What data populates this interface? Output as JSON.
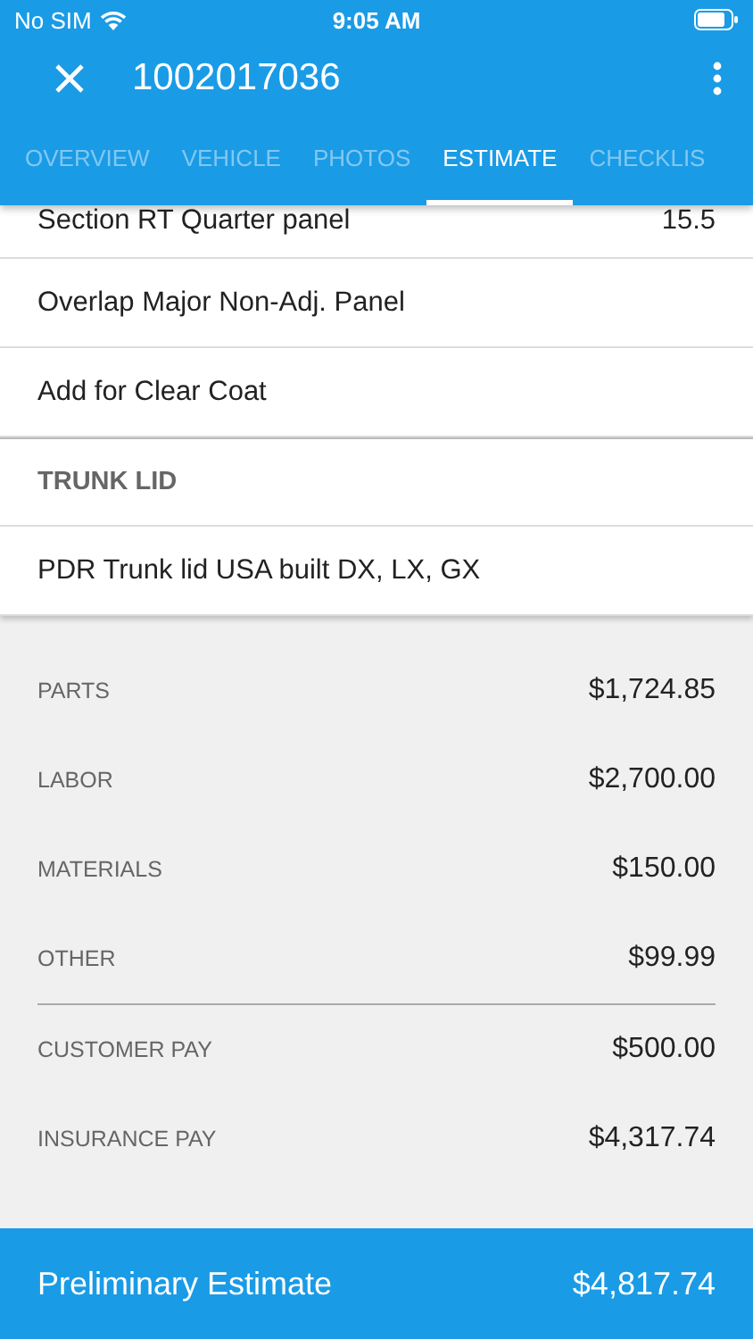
{
  "status_bar": {
    "carrier": "No SIM",
    "time": "9:05 AM"
  },
  "header": {
    "title": "1002017036"
  },
  "tabs": [
    {
      "label": "OVERVIEW",
      "selected": false
    },
    {
      "label": "VEHICLE",
      "selected": false
    },
    {
      "label": "PHOTOS",
      "selected": false
    },
    {
      "label": "ESTIMATE",
      "selected": true
    },
    {
      "label": "CHECKLIS",
      "selected": false
    }
  ],
  "lines": [
    {
      "kind": "item",
      "label": "Section RT Quarter panel",
      "value": "15.5"
    },
    {
      "kind": "item",
      "label": "Overlap Major Non-Adj. Panel"
    },
    {
      "kind": "item",
      "label": "Add for Clear Coat"
    },
    {
      "kind": "section",
      "label": "TRUNK LID"
    },
    {
      "kind": "item",
      "label": "PDR Trunk lid USA built DX, LX, GX"
    }
  ],
  "totals": [
    {
      "label": "PARTS",
      "value": "$1,724.85"
    },
    {
      "label": "LABOR",
      "value": "$2,700.00"
    },
    {
      "label": "MATERIALS",
      "value": "$150.00"
    },
    {
      "label": "OTHER",
      "value": "$99.99"
    },
    {
      "label": "CUSTOMER PAY",
      "value": "$500.00"
    },
    {
      "label": "INSURANCE PAY",
      "value": "$4,317.74"
    }
  ],
  "footer": {
    "label": "Preliminary Estimate",
    "total": "$4,817.74"
  }
}
